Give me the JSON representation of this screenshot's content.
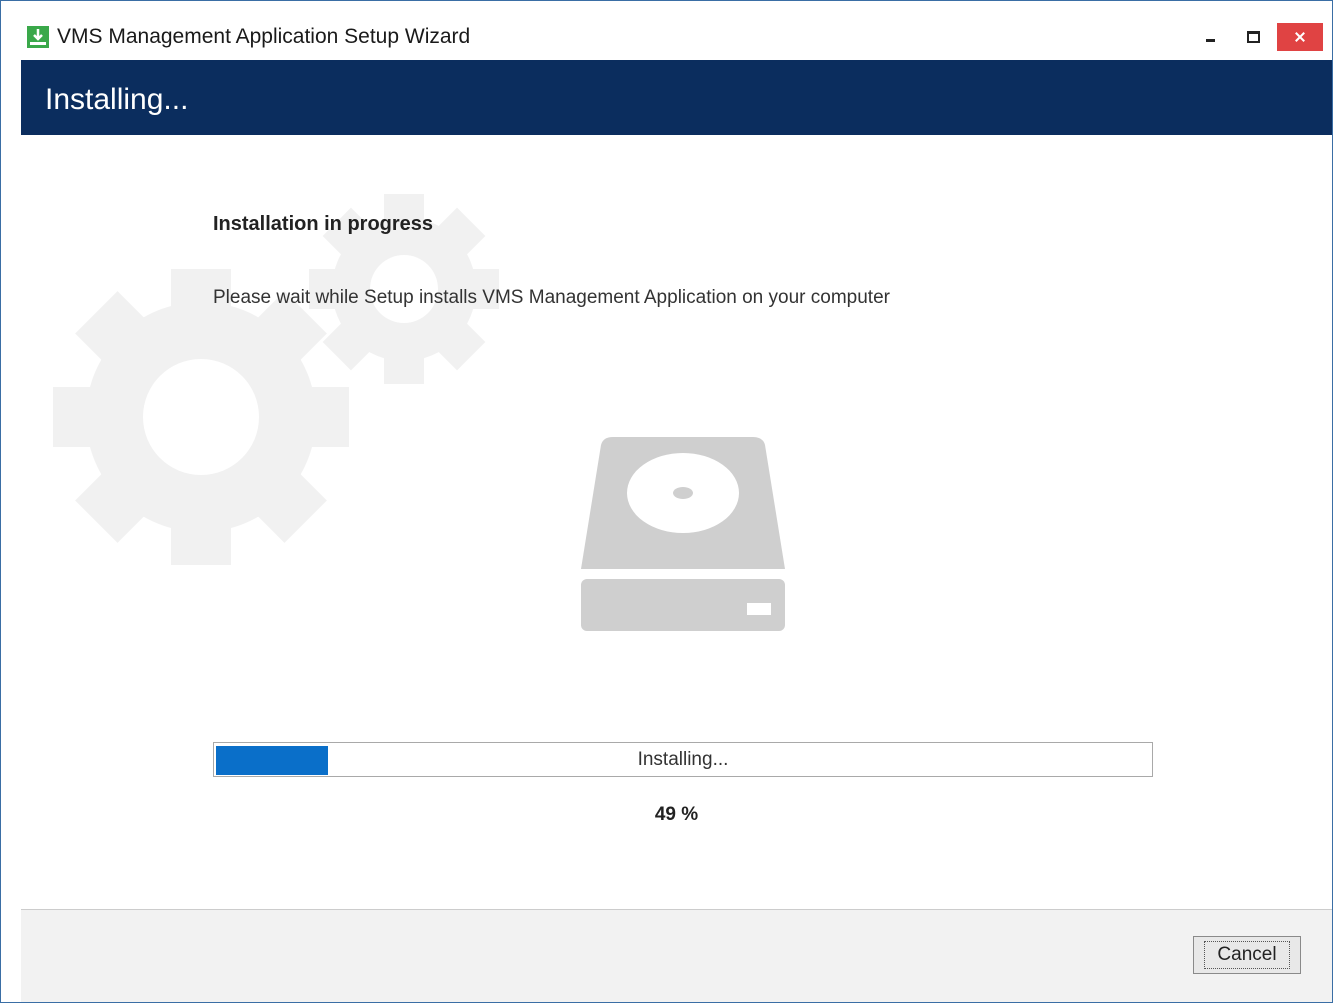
{
  "window": {
    "title": "VMS Management Application Setup Wizard",
    "controls": [
      "minimize-icon",
      "maximize-icon",
      "close-icon"
    ],
    "close_color": "#e04343"
  },
  "header": {
    "title": "Installing...",
    "background": "#0b2d5e"
  },
  "main": {
    "heading": "Installation in progress",
    "description": "Please wait while Setup installs VMS Management Application on your computer",
    "illustration": "hard-disk-icon",
    "background_decoration": "gears-icon"
  },
  "progress": {
    "label": "Installing...",
    "fill_fraction": 0.12,
    "fill_color": "#0a6fc9",
    "percent_text": "49 %"
  },
  "footer": {
    "cancel_label": "Cancel"
  }
}
